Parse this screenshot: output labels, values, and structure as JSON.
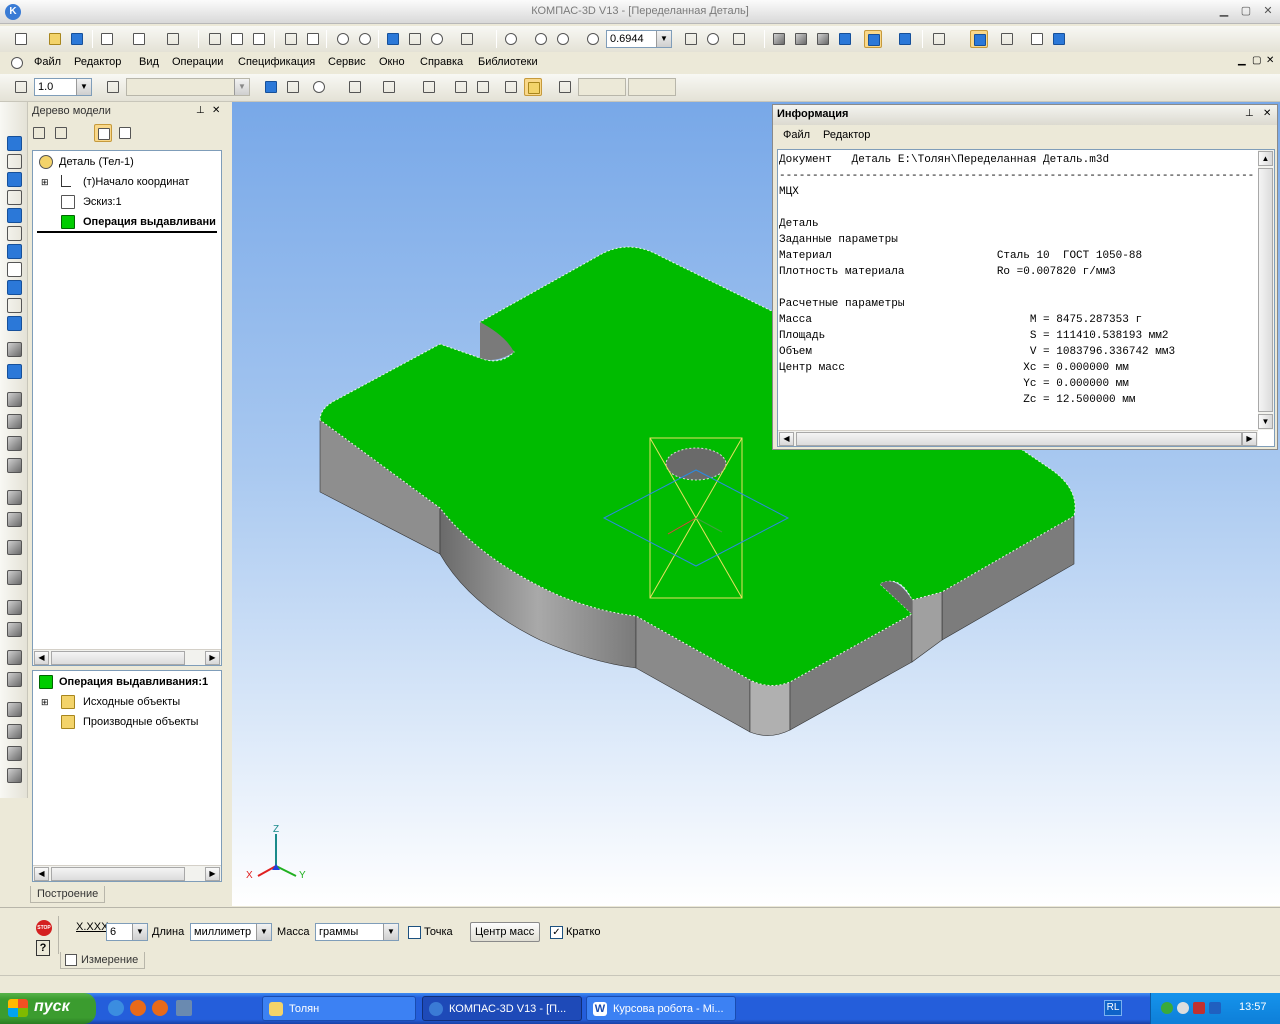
{
  "window": {
    "title": "КОМПАС-3D V13 - [Переделанная Деталь]",
    "logo": "K"
  },
  "toolbar1": {
    "zoom": "0.6944"
  },
  "menu": {
    "items": [
      "Файл",
      "Редактор",
      "Вид",
      "Операции",
      "Спецификация",
      "Сервис",
      "Окно",
      "Справка",
      "Библиотеки"
    ]
  },
  "toolbar2": {
    "scale": "1.0"
  },
  "tree": {
    "title": "Дерево модели",
    "root": "Деталь (Тел-1)",
    "items": [
      "(т)Начало координат",
      "Эскиз:1",
      "Операция выдавливани"
    ],
    "bottom_title": "Операция выдавливания:1",
    "bottom_items": [
      "Исходные объекты",
      "Производные объекты"
    ],
    "tab": "Построение"
  },
  "axes": {
    "x": "X",
    "y": "Y",
    "z": "Z"
  },
  "info": {
    "title": "Информация",
    "menu": [
      "Файл",
      "Редактор"
    ],
    "lines": [
      "Документ   Деталь E:\\Толян\\Переделанная Деталь.m3d",
      "------------------------------------------------------------------------",
      "МЦХ",
      "",
      "Деталь",
      "Заданные параметры",
      "Материал                         Сталь 10  ГОСТ 1050-88",
      "Плотность материала              Ro =0.007820 г/мм3",
      "",
      "Расчетные параметры",
      "Масса                                 M = 8475.287353 г",
      "Площадь                               S = 111410.538193 мм2",
      "Объем                                 V = 1083796.336742 мм3",
      "Центр масс                           Xc = 0.000000 мм",
      "                                     Yc = 0.000000 мм",
      "                                     Zc = 12.500000 мм"
    ]
  },
  "props": {
    "precision_label": "X.XXX",
    "precision": "6",
    "length_label": "Длина",
    "length": "миллиметр",
    "mass_label": "Масса",
    "mass": "граммы",
    "point_label": "Точка",
    "center_btn": "Центр масс",
    "brief_label": "Кратко",
    "stop": "STOP",
    "help": "?",
    "tab": "Измерение"
  },
  "taskbar": {
    "start": "пуск",
    "tasks": [
      "Толян",
      "КОМПАС-3D V13 - [П...",
      "Курсова робота - Mi..."
    ],
    "lang": "RL",
    "clock": "13:57"
  },
  "colors": {
    "part_top": "#00bb00",
    "part_side": "#8a8a8a",
    "sky": "#78a8e8"
  }
}
